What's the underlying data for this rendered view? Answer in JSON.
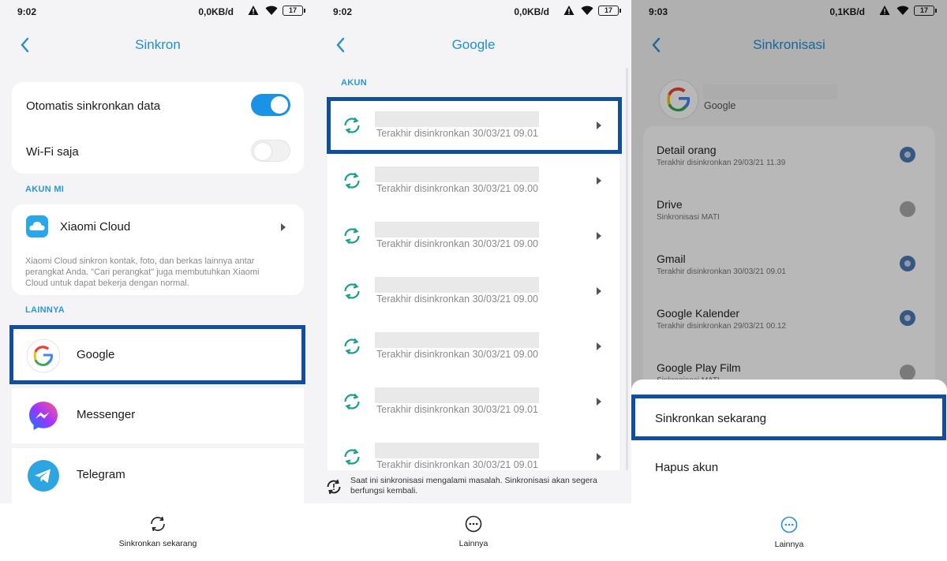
{
  "colors": {
    "accent": "#1f8fd6",
    "highlight": "#114f9b",
    "sync_green": "#1aa18a",
    "dim": "#adadad"
  },
  "panel1": {
    "status": {
      "time": "9:02",
      "network": "0,0KB/d",
      "battery": "17"
    },
    "title": "Sinkron",
    "auto_sync_label": "Otomatis sinkronkan data",
    "auto_sync_on": true,
    "wifi_only_label": "Wi-Fi saja",
    "wifi_only_on": false,
    "section_mi": "AKUN MI",
    "xiaomi_cloud_label": "Xiaomi Cloud",
    "xiaomi_cloud_desc": "Xiaomi Cloud sinkron kontak, foto, dan berkas lainnya antar perangkat Anda. \"Cari perangkat\" juga membutuhkan Xiaomi Cloud untuk dapat bekerja dengan normal.",
    "section_other": "LAINNYA",
    "apps": [
      {
        "label": "Google",
        "icon": "google-icon"
      },
      {
        "label": "Messenger",
        "icon": "messenger-icon"
      },
      {
        "label": "Telegram",
        "icon": "telegram-icon"
      }
    ],
    "bottom_label": "Sinkronkan sekarang"
  },
  "panel2": {
    "status": {
      "time": "9:02",
      "network": "0,0KB/d",
      "battery": "17"
    },
    "title": "Google",
    "section": "AKUN",
    "accounts": [
      {
        "sub": "Terakhir disinkronkan 30/03/21 09.01"
      },
      {
        "sub": "Terakhir disinkronkan 30/03/21 09.00"
      },
      {
        "sub": "Terakhir disinkronkan 30/03/21 09.00"
      },
      {
        "sub": "Terakhir disinkronkan 30/03/21 09.00"
      },
      {
        "sub": "Terakhir disinkronkan 30/03/21 09.00"
      },
      {
        "sub": "Terakhir disinkronkan 30/03/21 09.01"
      },
      {
        "sub": "Terakhir disinkronkan 30/03/21 09.01"
      }
    ],
    "error_msg": "Saat ini sinkronisasi mengalami masalah. Sinkronisasi akan segera berfungsi kembali.",
    "bottom_label": "Lainnya"
  },
  "panel3": {
    "status": {
      "time": "9:03",
      "network": "0,1KB/d",
      "battery": "17"
    },
    "title": "Sinkronisasi",
    "account_type": "Google",
    "items": [
      {
        "name": "Detail orang",
        "sub": "Terakhir disinkronkan 29/03/21 11.39",
        "on": true
      },
      {
        "name": "Drive",
        "sub": "Sinkronisasi MATI",
        "on": false
      },
      {
        "name": "Gmail",
        "sub": "Terakhir disinkronkan 30/03/21 09.01",
        "on": true
      },
      {
        "name": "Google Kalender",
        "sub": "Terakhir disinkronkan 29/03/21 00.12",
        "on": true
      },
      {
        "name": "Google Play Film",
        "sub": "Sinkronisasi MATI",
        "on": false
      }
    ],
    "menu": [
      "Sinkronkan sekarang",
      "Hapus akun"
    ],
    "bottom_label": "Lainnya"
  }
}
